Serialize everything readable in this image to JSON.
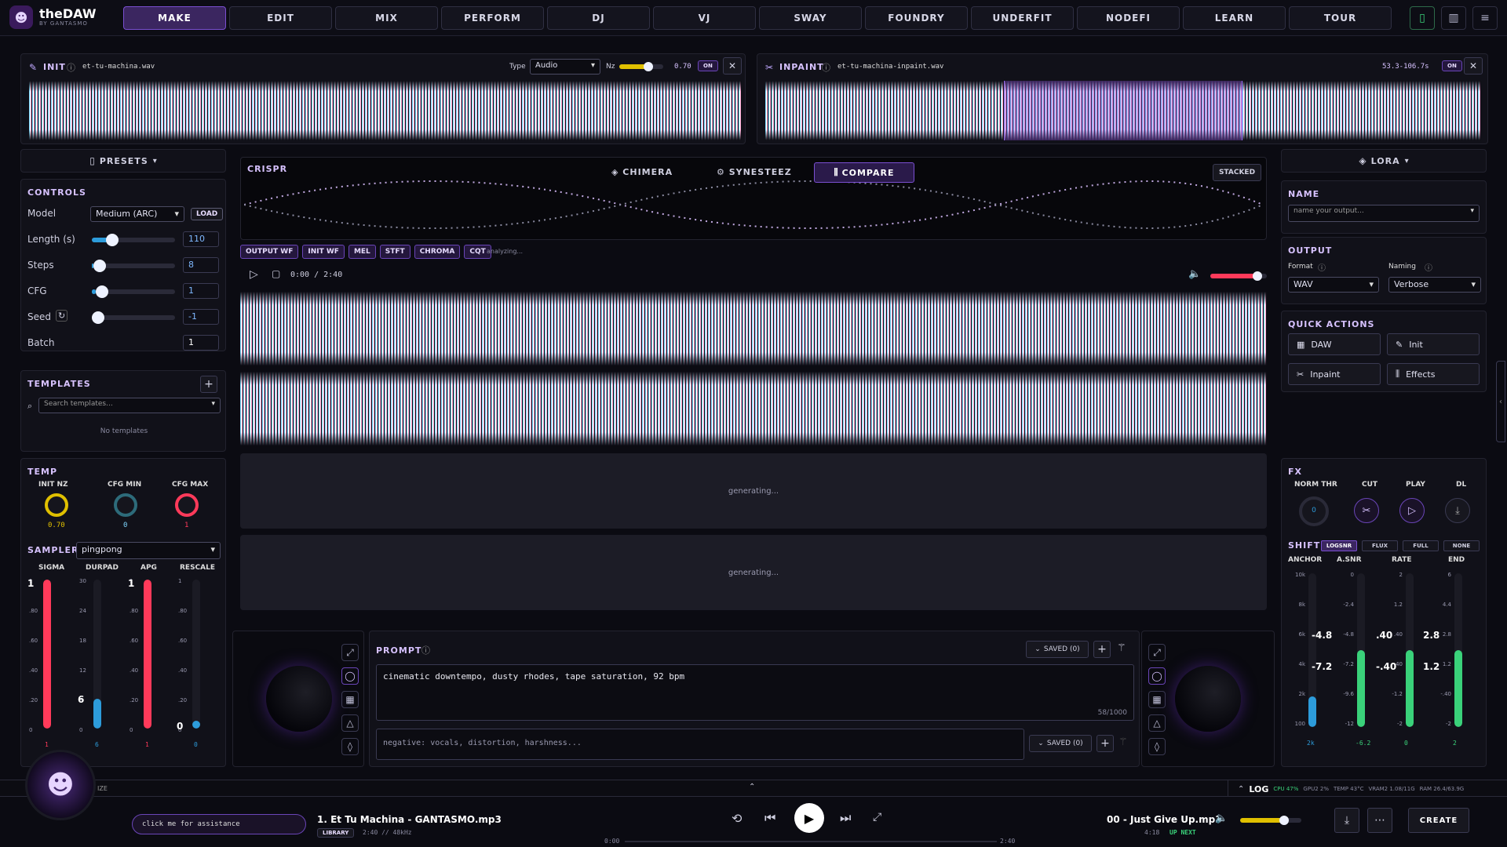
{
  "app": {
    "name": "theDAW",
    "subtitle": "BY GANTASMO"
  },
  "nav": [
    "MAKE",
    "EDIT",
    "MIX",
    "PERFORM",
    "DJ",
    "VJ",
    "SWAY",
    "FOUNDRY",
    "UNDERFIT",
    "NODEFI",
    "LEARN",
    "TOUR"
  ],
  "init": {
    "label": "INIT",
    "file": "et-tu-machina.wav",
    "type_label": "Type",
    "type_value": "Audio",
    "nz_label": "Nz",
    "nz_value": "0.70",
    "nz_level": 0.7,
    "on": "ON"
  },
  "inpaint": {
    "label": "INPAINT",
    "file": "et-tu-machina-inpaint.wav",
    "range": "53.3-106.7s",
    "on": "ON"
  },
  "presets": "PRESETS",
  "lora": "LORA",
  "controls": {
    "title": "CONTROLS",
    "model_label": "Model",
    "model_value": "Medium (ARC)",
    "load": "LOAD",
    "rows": [
      {
        "label": "Length (s)",
        "value": "110",
        "level": 0.2
      },
      {
        "label": "Steps",
        "value": "8",
        "level": 0.02
      },
      {
        "label": "CFG",
        "value": "1",
        "level": 0.05
      },
      {
        "label": "Seed",
        "value": "-1",
        "level": 0.0
      },
      {
        "label": "Batch",
        "value": "1"
      }
    ]
  },
  "templates": {
    "title": "TEMPLATES",
    "search_placeholder": "Search templates...",
    "empty": "No templates"
  },
  "temp": {
    "title": "TEMP",
    "knobs": [
      {
        "label": "INIT NZ",
        "value": "0.70"
      },
      {
        "label": "CFG MIN",
        "value": "0"
      },
      {
        "label": "CFG MAX",
        "value": "1"
      }
    ]
  },
  "sampler": {
    "label": "SAMPLER",
    "value": "pingpong"
  },
  "faders": {
    "labels": [
      "SIGMA",
      "DURPAD",
      "APG",
      "RESCALE"
    ],
    "values": [
      "1",
      "6",
      "1",
      "0"
    ],
    "sigma_ticks": [
      "1",
      ".80",
      ".60",
      ".40",
      ".20",
      "0"
    ],
    "durpad_ticks": [
      "30",
      "24",
      "18",
      "12",
      "6",
      "0"
    ],
    "apg_ticks": [
      "1",
      ".80",
      ".60",
      ".40",
      ".20",
      "0"
    ],
    "rescale_ticks": [
      "1",
      ".80",
      ".60",
      ".40",
      ".20",
      "0"
    ],
    "markers": [
      "1",
      "6",
      "1",
      "0"
    ],
    "levels": [
      1,
      0.2,
      1,
      0
    ]
  },
  "crispr": {
    "title": "CRISPR",
    "tabs": [
      "CHIMERA",
      "SYNESTEEZ",
      "COMPARE"
    ],
    "stacked": "STACKED",
    "views": [
      "OUTPUT WF",
      "INIT WF",
      "MEL",
      "STFT",
      "CHROMA",
      "CQT"
    ],
    "status": "analyzing...",
    "time": "0:00 / 2:40",
    "volume": 0.9
  },
  "generating": [
    "generating...",
    "generating..."
  ],
  "prompt": {
    "title": "PROMPT",
    "saved": "SAVED (0)",
    "text": "cinematic downtempo, dusty rhodes, tape saturation, 92 bpm",
    "count": "58/1000",
    "negative": "negative: vocals, distortion, harshness..."
  },
  "name": {
    "title": "NAME",
    "placeholder": "name your output..."
  },
  "output": {
    "title": "OUTPUT",
    "format_label": "Format",
    "format_value": "WAV",
    "naming_label": "Naming",
    "naming_value": "Verbose"
  },
  "quick": {
    "title": "QUICK ACTIONS",
    "items": [
      "DAW",
      "Init",
      "Inpaint",
      "Effects"
    ]
  },
  "fx": {
    "title": "FX",
    "labels": [
      "NORM THR",
      "CUT",
      "PLAY",
      "DL"
    ],
    "norm_value": "0"
  },
  "shift": {
    "title": "SHIFT",
    "modes": [
      "LOGSNR",
      "FLUX",
      "FULL",
      "NONE"
    ],
    "labels": [
      "ANCHOR",
      "A.SNR",
      "RATE",
      "END"
    ],
    "anchor_ticks": [
      "10k",
      "8k",
      "6k",
      "4k",
      "2k",
      "100"
    ],
    "asnr_ticks": [
      "0",
      "-2.4",
      "-4.8",
      "-7.2",
      "-9.6",
      "-12"
    ],
    "rate_ticks": [
      "2",
      "1.2",
      ".40",
      "-.40",
      "-1.2",
      "-2"
    ],
    "end_ticks": [
      "6",
      "4.4",
      "2.8",
      "1.2",
      "-.40",
      "-2"
    ],
    "overlays": [
      "-4.8",
      "-7.2",
      ".40",
      "-.40",
      "2.8",
      "1.2"
    ],
    "values": [
      "2k",
      "-6.2",
      "0",
      "2"
    ],
    "levels": [
      0.2,
      0.5,
      0.5,
      0.5
    ]
  },
  "log": {
    "label": "LOG",
    "stats": [
      "CPU 47%",
      "GPU2 2%",
      "TEMP 43°C",
      "VRAM2 1.08/11G",
      "RAM 26.4/63.9G"
    ]
  },
  "status_left": "IZE",
  "player": {
    "assist": "click me for assistance",
    "track": "1. Et Tu Machina - GANTASMO.mp3",
    "library": "LIBRARY",
    "meta": "2:40 // 48kHz",
    "t0": "0:00",
    "t1": "2:40",
    "next": "00 - Just Give Up.mp3",
    "next_dur": "4:18",
    "up_next": "UP NEXT",
    "create": "CREATE",
    "volume": 0.75
  }
}
